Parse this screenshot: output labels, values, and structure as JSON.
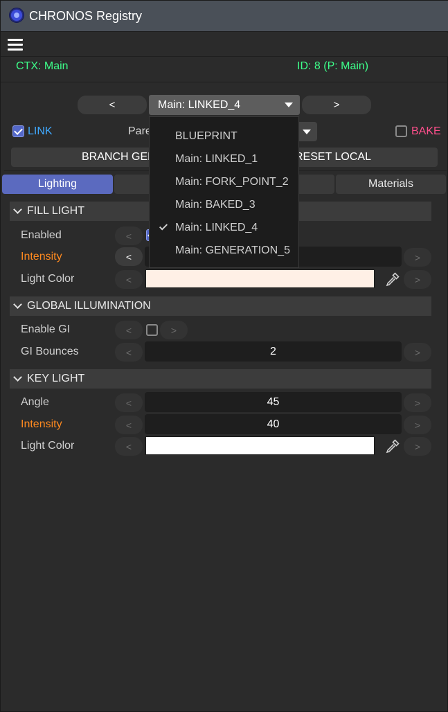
{
  "window": {
    "title": "CHRONOS Registry"
  },
  "context": {
    "ctx": "CTX: Main",
    "id": "ID: 8 (P: Main)"
  },
  "nav": {
    "prev": "<",
    "next": ">",
    "selected_version": "Main: LINKED_4",
    "link_label": "LINK",
    "link_checked": true,
    "parent_label": "Pare",
    "bake_label": "BAKE",
    "bake_checked": false,
    "branch_label": "BRANCH GEN",
    "reset_label": "RESET LOCAL"
  },
  "version_dropdown": {
    "items": [
      {
        "label": "BLUEPRINT",
        "checked": false
      },
      {
        "label": "Main: LINKED_1",
        "checked": false
      },
      {
        "label": "Main: FORK_POINT_2",
        "checked": false
      },
      {
        "label": "Main: BAKED_3",
        "checked": false
      },
      {
        "label": "Main: LINKED_4",
        "checked": true
      },
      {
        "label": "Main: GENERATION_5",
        "checked": false
      }
    ]
  },
  "tabs": [
    {
      "label": "Lighting",
      "active": true
    },
    {
      "label": "",
      "active": false
    },
    {
      "label": "Materials",
      "active": false
    }
  ],
  "sections": {
    "fill_light": {
      "title": "FILL LIGHT",
      "enabled_label": "Enabled",
      "intensity_label": "Intensity",
      "light_color_label": "Light Color",
      "light_color": "#fff0e6"
    },
    "global_illumination": {
      "title": "GLOBAL ILLUMINATION",
      "enable_gi_label": "Enable GI",
      "enable_gi": false,
      "gi_bounces_label": "GI Bounces",
      "gi_bounces": "2"
    },
    "key_light": {
      "title": "KEY LIGHT",
      "angle_label": "Angle",
      "angle": "45",
      "intensity_label": "Intensity",
      "intensity": "40",
      "light_color_label": "Light Color",
      "light_color": "#ffffff"
    }
  },
  "arrows": {
    "left": "<",
    "right": ">"
  },
  "colors": {
    "accent": "#5b6abf",
    "ctx_green": "#3dff8a",
    "link_blue": "#3fa9ff",
    "bake_pink": "#ff4f8c",
    "animated_orange": "#ff8a1f"
  }
}
